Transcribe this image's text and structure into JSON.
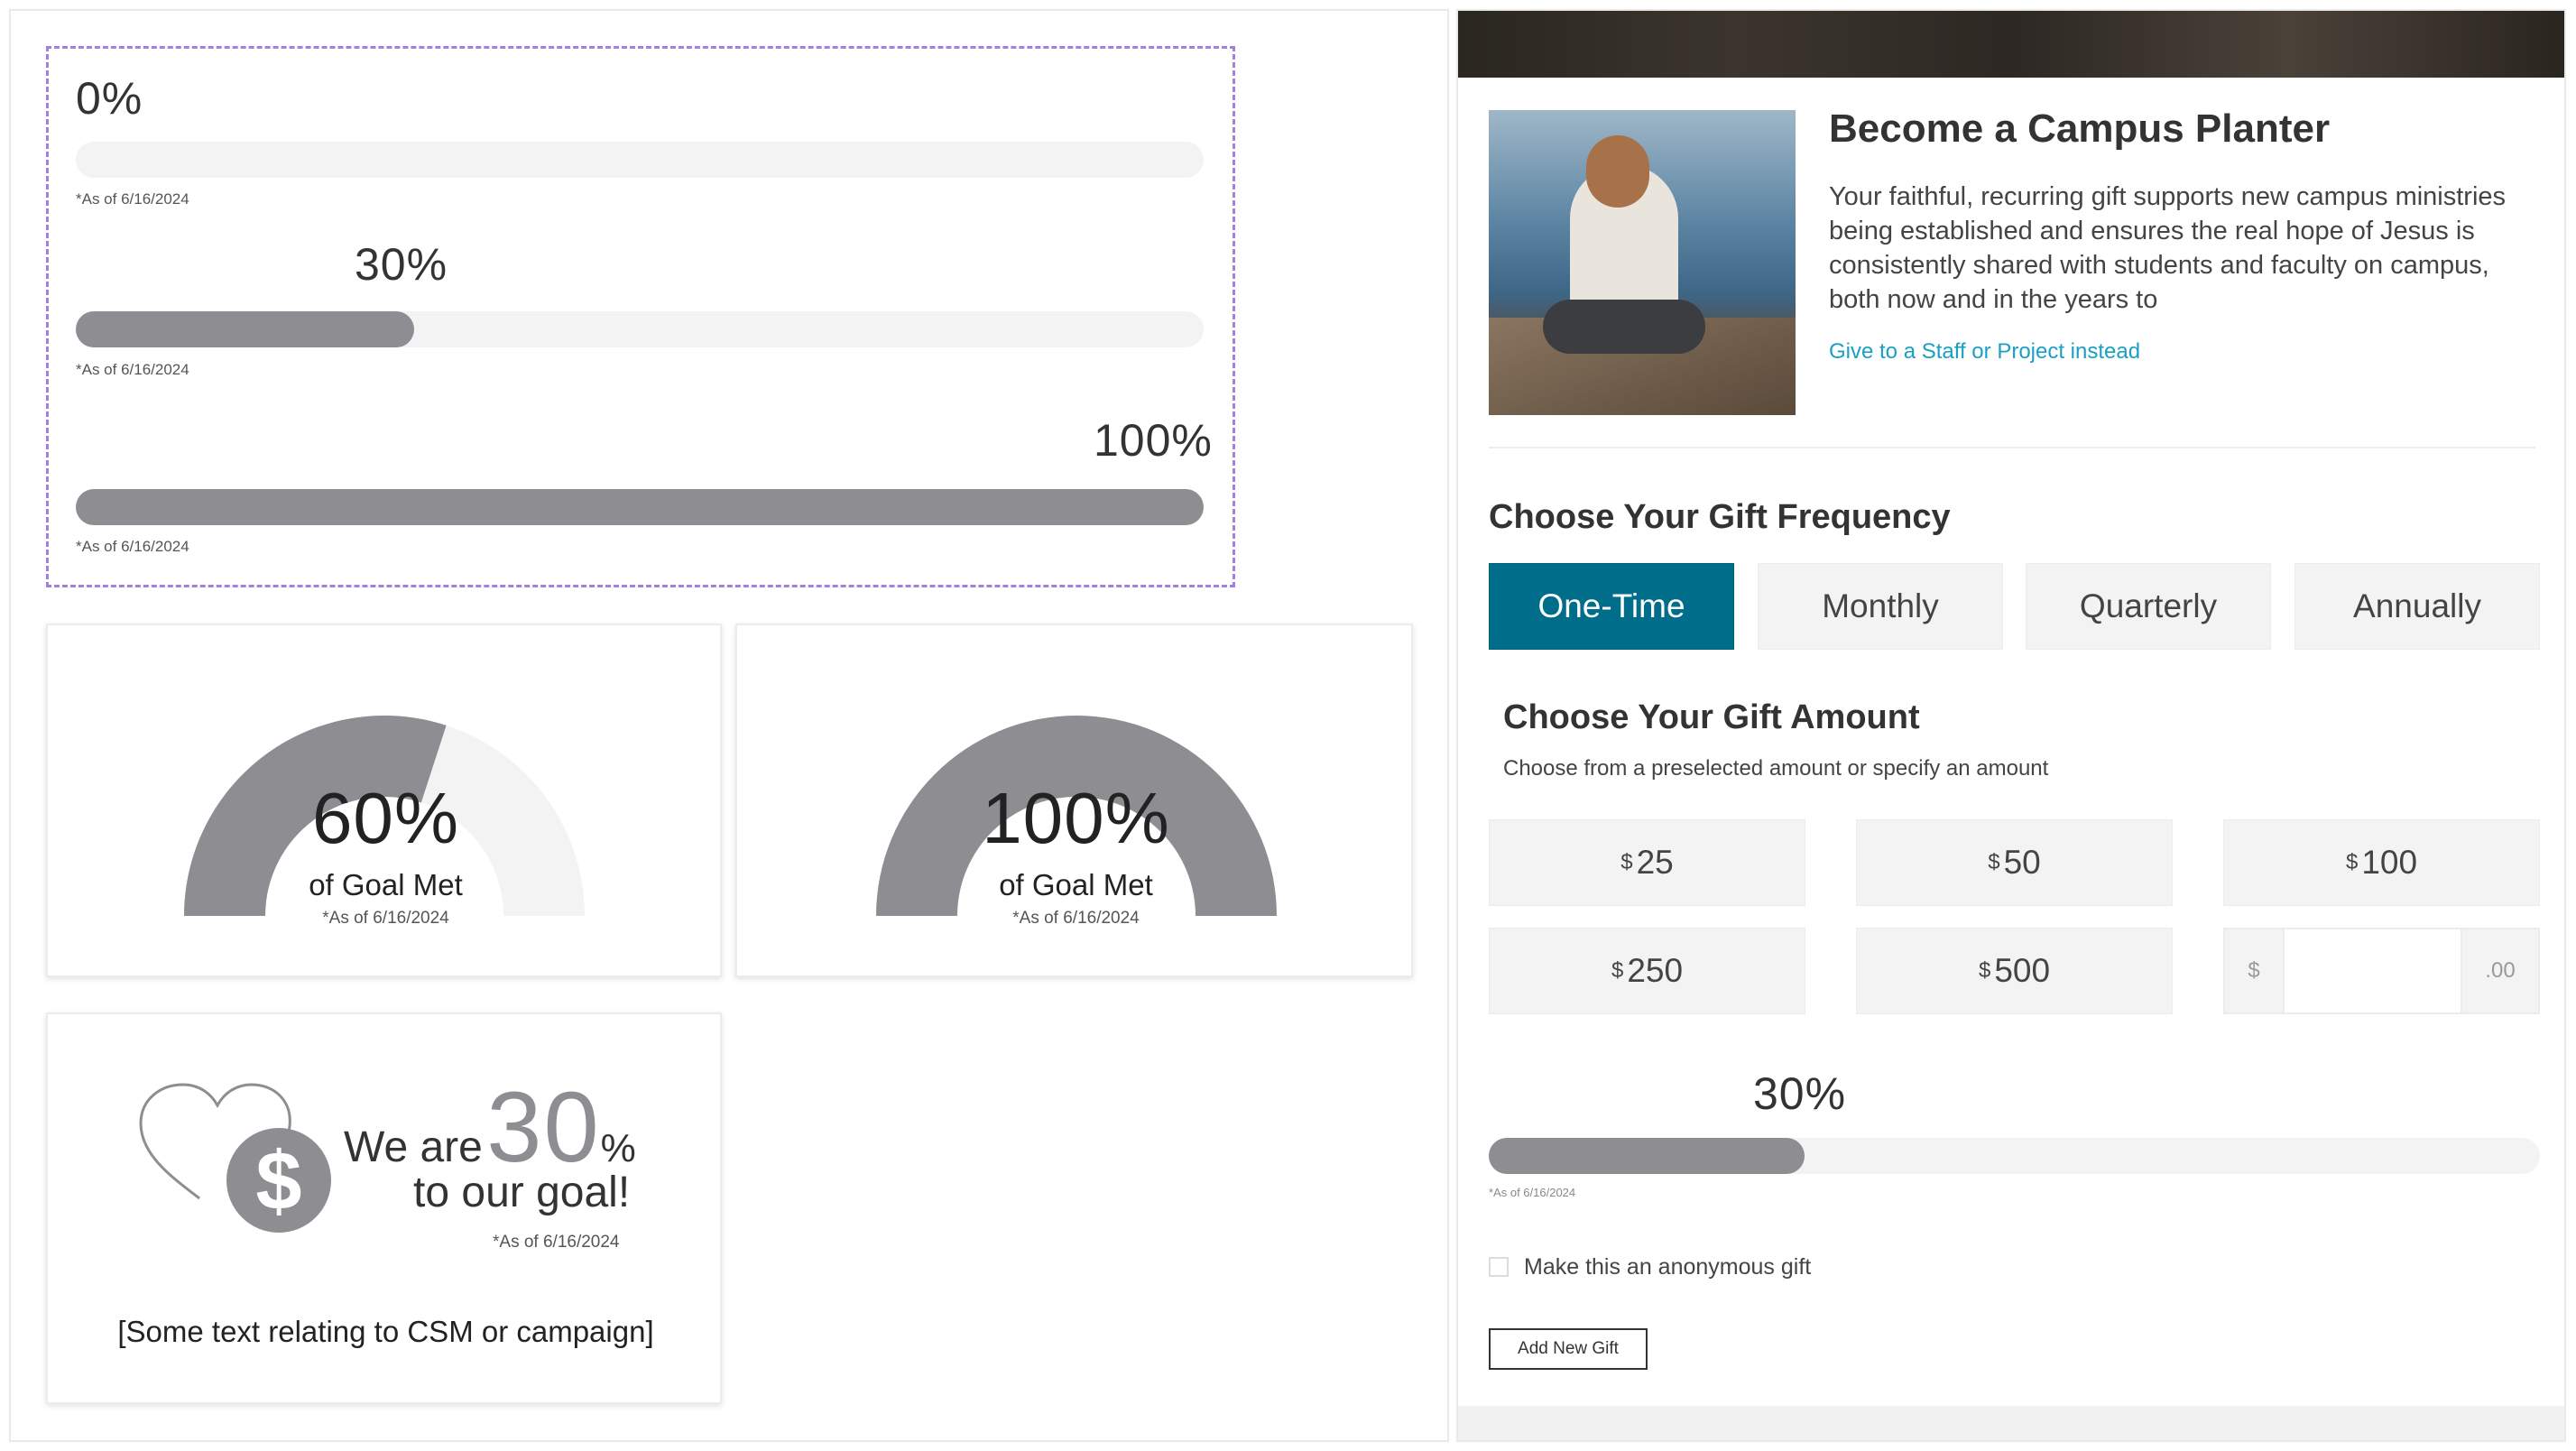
{
  "progress_bars": [
    {
      "label": "0%",
      "value": 0,
      "asof": "*As of 6/16/2024"
    },
    {
      "label": "30%",
      "value": 0.3,
      "asof": "*As of 6/16/2024"
    },
    {
      "label": "100%",
      "value": 1.0,
      "asof": "*As of 6/16/2024"
    }
  ],
  "gauges": [
    {
      "label": "60%",
      "value": 0.6,
      "sub": "of Goal Met",
      "asof": "*As of 6/16/2024"
    },
    {
      "label": "100%",
      "value": 1.0,
      "sub": "of Goal Met",
      "asof": "*As of 6/16/2024"
    }
  ],
  "goal_card": {
    "we_are": "We are",
    "number": "30",
    "pct": "%",
    "to_goal": "to our goal!",
    "asof": "*As of 6/16/2024",
    "caption": "[Some text relating to CSM or campaign]",
    "icon": "heart-dollar-icon"
  },
  "donation": {
    "title": "Become a Campus Planter",
    "description": "Your faithful, recurring gift supports new campus ministries being established and ensures the real hope of Jesus is consistently shared with students and faculty on campus, both now and in the years to",
    "link": "Give to a Staff or Project instead",
    "frequency_heading": "Choose Your Gift Frequency",
    "frequencies": [
      "One-Time",
      "Monthly",
      "Quarterly",
      "Annually"
    ],
    "active_frequency": "One-Time",
    "amount_heading": "Choose Your Gift Amount",
    "amount_sub": "Choose from a preselected amount or specify an amount",
    "currency": "$",
    "amounts": [
      "25",
      "50",
      "100",
      "250",
      "500"
    ],
    "custom_prefix": "$",
    "custom_suffix": ".00",
    "custom_value": "",
    "progress": {
      "label": "30%",
      "value": 0.3,
      "asof": "*As of 6/16/2024"
    },
    "anonymous_label": "Make this an anonymous gift",
    "anonymous_checked": false,
    "add_button": "Add New Gift"
  },
  "colors": {
    "accent": "#006e8a",
    "link": "#1aa0c4",
    "fill": "#8e8e92",
    "track": "#f3f3f3",
    "dashed": "#a67ee0"
  }
}
